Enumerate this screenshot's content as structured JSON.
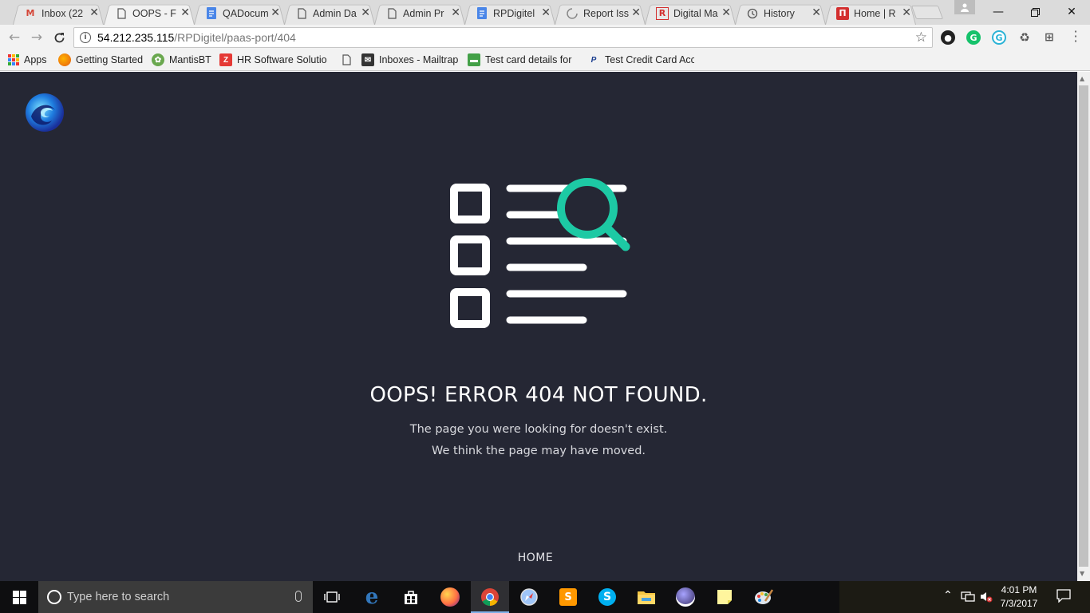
{
  "browser": {
    "tabs": [
      {
        "title": "Inbox (22",
        "favicon": "gmail-icon",
        "color": "#d44638",
        "active": false
      },
      {
        "title": "OOPS - F",
        "favicon": "page-icon",
        "color": "#555555",
        "active": true
      },
      {
        "title": "QADocum",
        "favicon": "google-docs-icon",
        "color": "#4a86e8",
        "active": false
      },
      {
        "title": "Admin Da",
        "favicon": "page-icon",
        "color": "#555555",
        "active": false
      },
      {
        "title": "Admin Pr",
        "favicon": "page-icon",
        "color": "#555555",
        "active": false
      },
      {
        "title": "RPDigitel",
        "favicon": "google-docs-icon",
        "color": "#4a86e8",
        "active": false
      },
      {
        "title": "Report Iss",
        "favicon": "loading-icon",
        "color": "#888888",
        "active": false
      },
      {
        "title": "Digital Ma",
        "favicon": "r-logo-icon",
        "color": "#d32f2f",
        "active": false
      },
      {
        "title": "History",
        "favicon": "history-icon",
        "color": "#555555",
        "active": false
      },
      {
        "title": "Home | R",
        "favicon": "rp-logo-icon",
        "color": "#d32f2f",
        "active": false
      }
    ],
    "address_bar": {
      "host": "54.212.235.115",
      "path": "/RPDigitel/paas-port/404"
    },
    "bookmarks": [
      {
        "label": "Apps",
        "icon": "apps-grid-icon"
      },
      {
        "label": "Getting Started",
        "icon": "firefox-icon"
      },
      {
        "label": "MantisBT",
        "icon": "mantis-icon"
      },
      {
        "label": "HR Software Solution",
        "icon": "zoho-icon"
      },
      {
        "label": "",
        "icon": "page-icon"
      },
      {
        "label": "Inboxes - Mailtrap",
        "icon": "mailtrap-icon"
      },
      {
        "label": "Test card details for y",
        "icon": "card-icon"
      },
      {
        "label": "Test Credit Card Acco",
        "icon": "paypal-icon"
      }
    ]
  },
  "page": {
    "headline": "OOPS! ERROR 404 NOT FOUND.",
    "message_line1": "The page you were looking for doesn't exist.",
    "message_line2": "We think the page may have moved.",
    "home_link": "HOME",
    "accent_color": "#1dc9a4",
    "background_color": "#252734"
  },
  "taskbar": {
    "search_placeholder": "Type here to search",
    "clock_time": "4:01 PM",
    "clock_date": "7/3/2017",
    "pinned": [
      "task-view-icon",
      "edge-icon",
      "store-icon",
      "firefox-icon",
      "chrome-icon",
      "safari-icon",
      "sublime-icon",
      "skype-icon",
      "file-explorer-icon",
      "eclipse-icon",
      "sticky-notes-icon",
      "paint-icon"
    ]
  }
}
